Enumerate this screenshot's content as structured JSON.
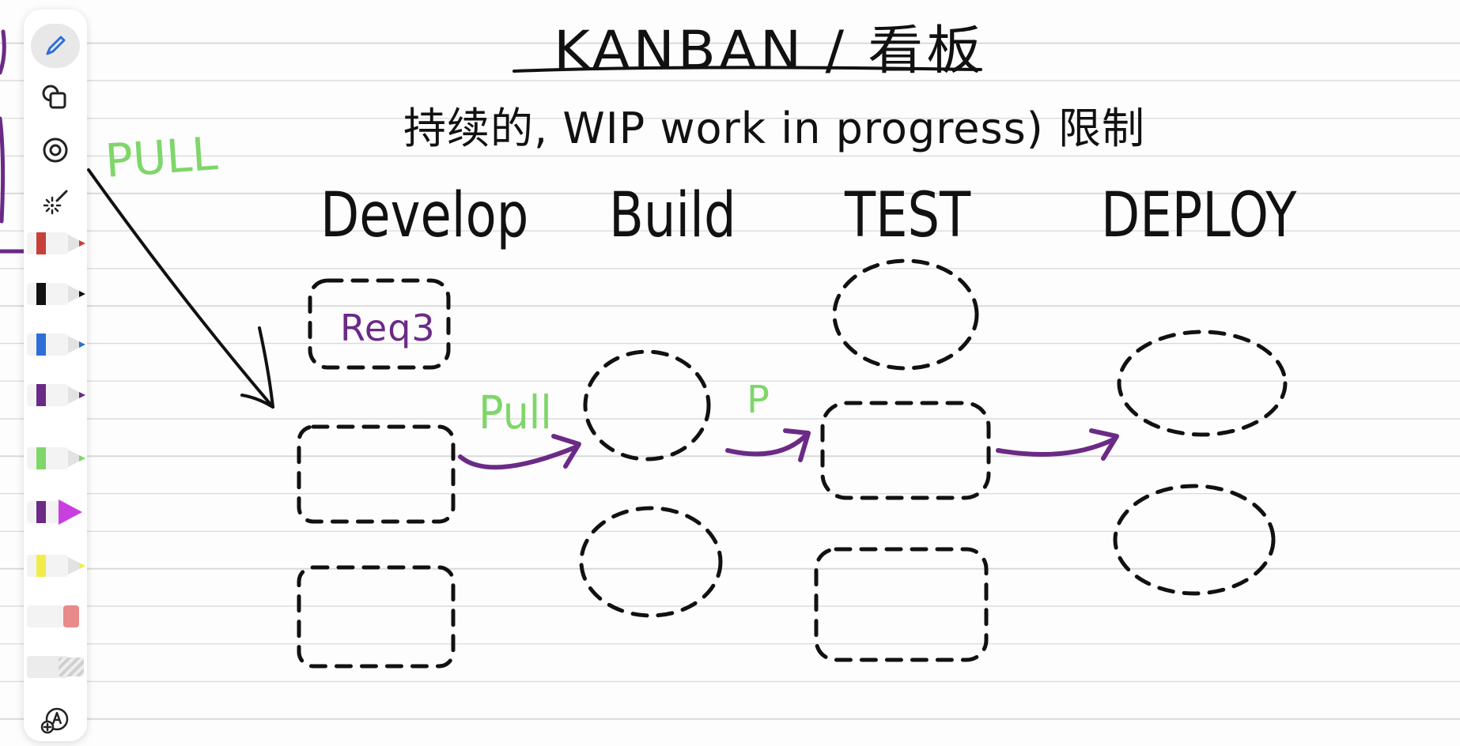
{
  "note": {
    "title": "KANBAN / 看板",
    "subtitle": "持续的, WIP work in progress) 限制",
    "columns": [
      {
        "name": "Develop"
      },
      {
        "name": "Build"
      },
      {
        "name": "TEST"
      },
      {
        "name": "DEPLOY"
      }
    ],
    "annotations": {
      "pull_top": "PULL",
      "pull_mid": "Pull",
      "pull_small": "P"
    },
    "card_label": "Req3"
  },
  "toolbar": {
    "tools": [
      {
        "name": "pen-tool-icon",
        "active": true
      },
      {
        "name": "shapes-icon",
        "active": false
      },
      {
        "name": "lasso-icon",
        "active": false
      },
      {
        "name": "laser-pointer-icon",
        "active": false
      }
    ],
    "pens": [
      {
        "name": "red-pen",
        "color": "#c8403a"
      },
      {
        "name": "black-pen",
        "color": "#111111"
      },
      {
        "name": "blue-pen",
        "color": "#2d6fd6"
      },
      {
        "name": "purple-pen",
        "color": "#6b2a86"
      },
      {
        "name": "green-highlighter",
        "color": "#7fd66a"
      },
      {
        "name": "magenta-highlighter",
        "color": "#c83fe0"
      },
      {
        "name": "yellow-highlighter",
        "color": "#f2ec4a"
      },
      {
        "name": "eraser",
        "color": "#e88a8a"
      },
      {
        "name": "tape",
        "color": "#cfcfcf"
      }
    ],
    "bottom_tool": "add-lasso-tool-icon"
  },
  "colors": {
    "ink": "#111111",
    "purple": "#6b2a86",
    "green": "#7fd66a",
    "paper_line": "#d9d9d9"
  }
}
